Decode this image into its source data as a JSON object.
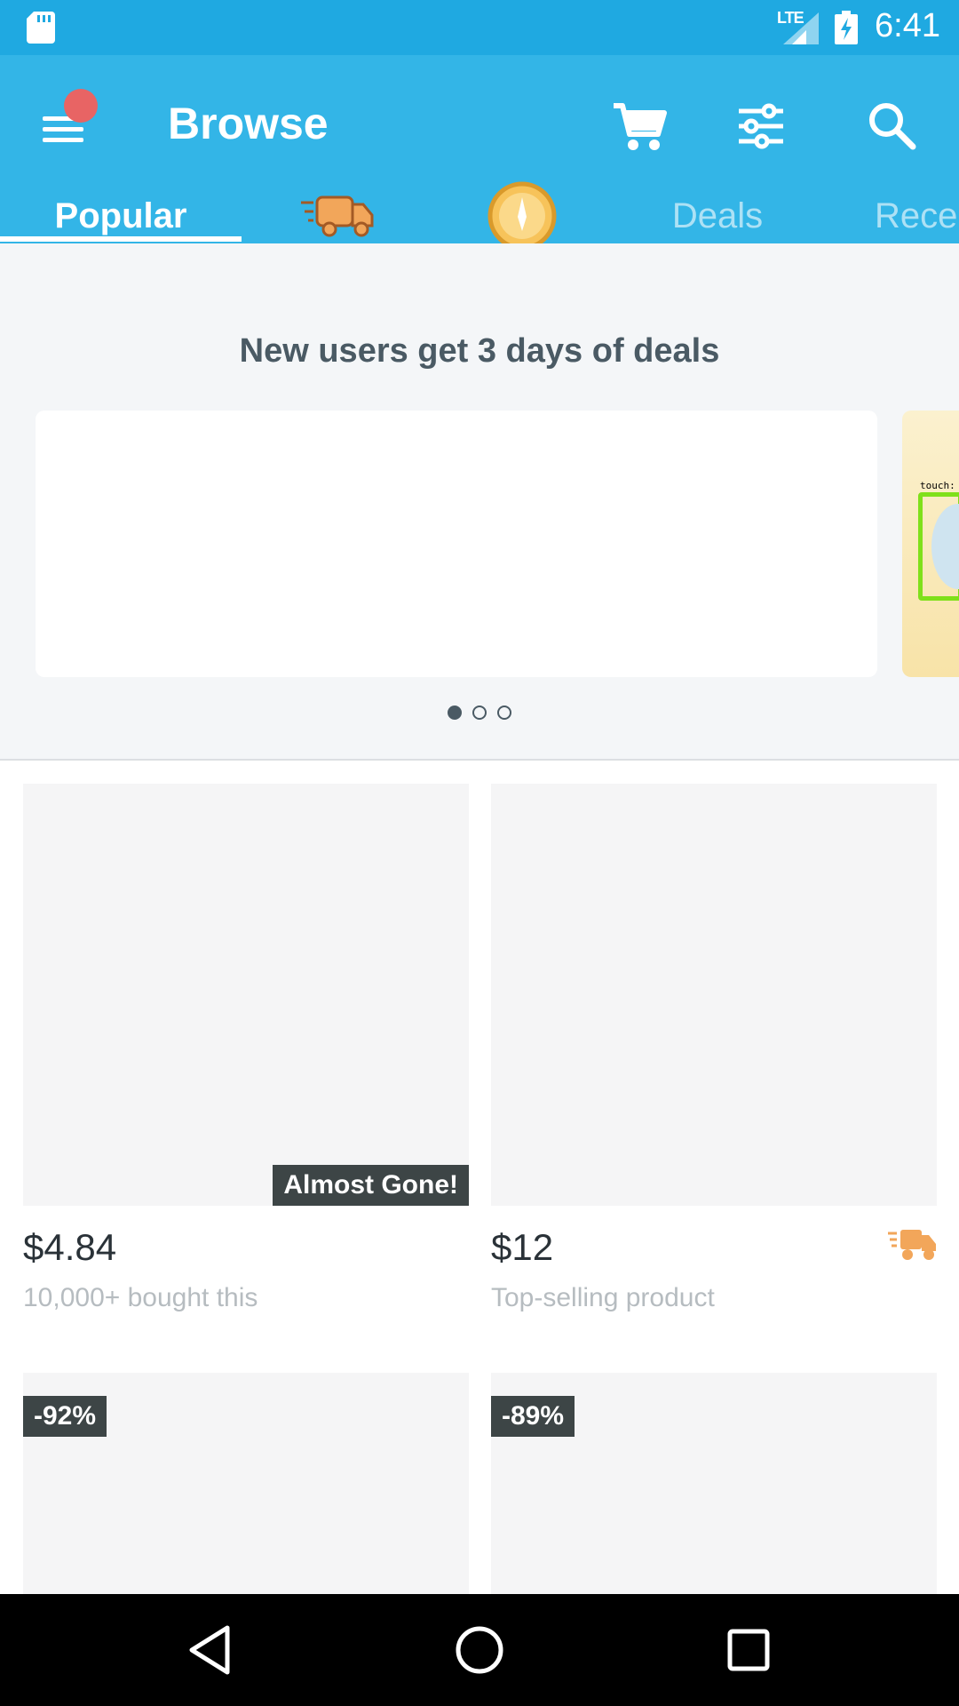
{
  "status_bar": {
    "network": "LTE",
    "time": "6:41"
  },
  "app_bar": {
    "title": "Browse",
    "notification_color": "#e86464"
  },
  "tabs": [
    {
      "label": "Popular",
      "active": true
    },
    {
      "label": "",
      "icon": "delivery-truck-icon"
    },
    {
      "label": "",
      "icon": "coin-icon"
    },
    {
      "label": "Deals"
    },
    {
      "label": "Rece"
    }
  ],
  "promo": {
    "title": "New users get 3 days of deals",
    "overlay_text": "touch:",
    "page_count": 3,
    "active_page": 1
  },
  "products": [
    {
      "price": "$4.84",
      "subtitle": "10,000+ bought this",
      "badge": "Almost Gone!"
    },
    {
      "price": "$12",
      "subtitle": "Top-selling product",
      "icon": "delivery-truck-icon"
    },
    {
      "badge": "-92%"
    },
    {
      "badge": "-89%"
    }
  ],
  "colors": {
    "status_bar": "#1fa9e1",
    "app_bar": "#33b5e7",
    "accent_orange": "#f2a65a"
  }
}
